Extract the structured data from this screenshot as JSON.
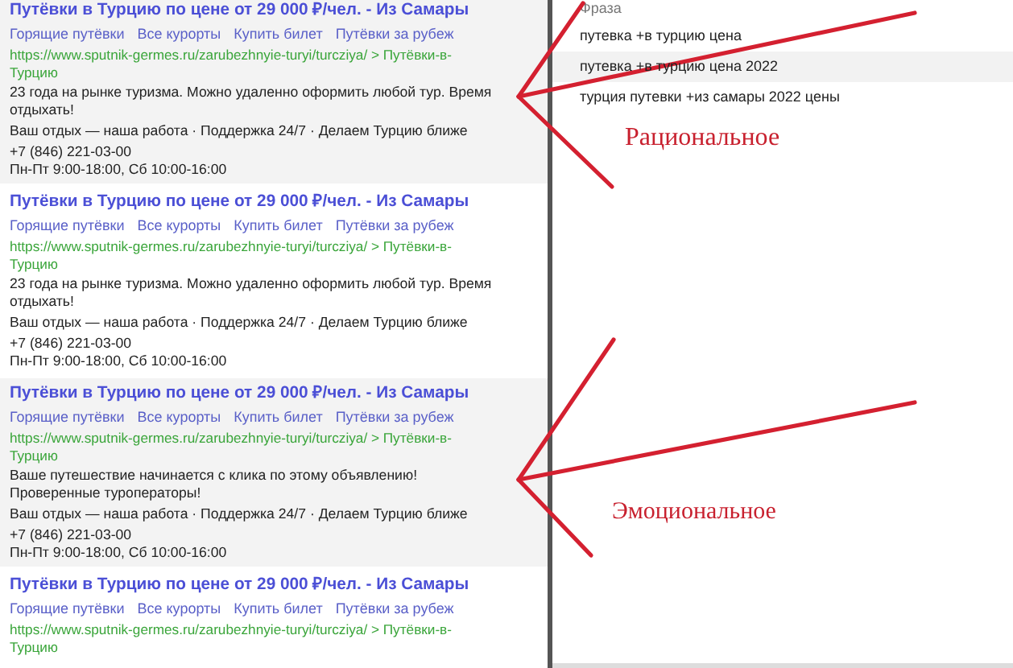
{
  "ads": [
    {
      "highlighted": true,
      "title": "Путёвки в Турцию по цене от 29 000 ₽/чел. - Из Самары",
      "sitelinks": [
        "Горящие путёвки",
        "Все курорты",
        "Купить билет",
        "Путёвки за рубеж"
      ],
      "url": "https://www.sputnik-germes.ru/zarubezhnyie-turyi/turcziya/ > Путёвки-в-Турцию",
      "text": "23 года на рынке туризма. Можно удаленно оформить любой тур. Время отдыхать!",
      "features": "Ваш отдых — наша работа · Поддержка 24/7 · Делаем Турцию ближе",
      "phone": "+7 (846) 221-03-00",
      "hours": "Пн-Пт 9:00-18:00, Сб 10:00-16:00"
    },
    {
      "highlighted": false,
      "title": "Путёвки в Турцию по цене от 29 000 ₽/чел. - Из Самары",
      "sitelinks": [
        "Горящие путёвки",
        "Все курорты",
        "Купить билет",
        "Путёвки за рубеж"
      ],
      "url": "https://www.sputnik-germes.ru/zarubezhnyie-turyi/turcziya/ > Путёвки-в-Турцию",
      "text": "23 года на рынке туризма. Можно удаленно оформить любой тур. Время отдыхать!",
      "features": "Ваш отдых — наша работа · Поддержка 24/7 · Делаем Турцию ближе",
      "phone": "+7 (846) 221-03-00",
      "hours": "Пн-Пт 9:00-18:00, Сб 10:00-16:00"
    },
    {
      "highlighted": true,
      "title": "Путёвки в Турцию по цене от 29 000 ₽/чел. - Из Самары",
      "sitelinks": [
        "Горящие путёвки",
        "Все курорты",
        "Купить билет",
        "Путёвки за рубеж"
      ],
      "url": "https://www.sputnik-germes.ru/zarubezhnyie-turyi/turcziya/ > Путёвки-в-Турцию",
      "text": "Ваше путешествие начинается с клика по этому объявлению! Проверенные туроператоры!",
      "features": "Ваш отдых — наша работа · Поддержка 24/7 · Делаем Турцию ближе",
      "phone": "+7 (846) 221-03-00",
      "hours": "Пн-Пт 9:00-18:00, Сб 10:00-16:00"
    },
    {
      "highlighted": false,
      "title": "Путёвки в Турцию по цене от 29 000 ₽/чел. - Из Самары",
      "sitelinks": [
        "Горящие путёвки",
        "Все курорты",
        "Купить билет",
        "Путёвки за рубеж"
      ],
      "url": "https://www.sputnik-germes.ru/zarubezhnyie-turyi/turcziya/ > Путёвки-в-Турцию"
    }
  ],
  "phrases": {
    "header": "Фраза",
    "rows": [
      {
        "text": "путевка +в турцию цена",
        "highlighted": false
      },
      {
        "text": "путевка +в турцию цена 2022",
        "highlighted": true
      },
      {
        "text": "турция путевки +из самары 2022 цены",
        "highlighted": false
      }
    ]
  },
  "annotations": [
    {
      "label": "Рациональное"
    },
    {
      "label": "Эмоциональное"
    }
  ]
}
